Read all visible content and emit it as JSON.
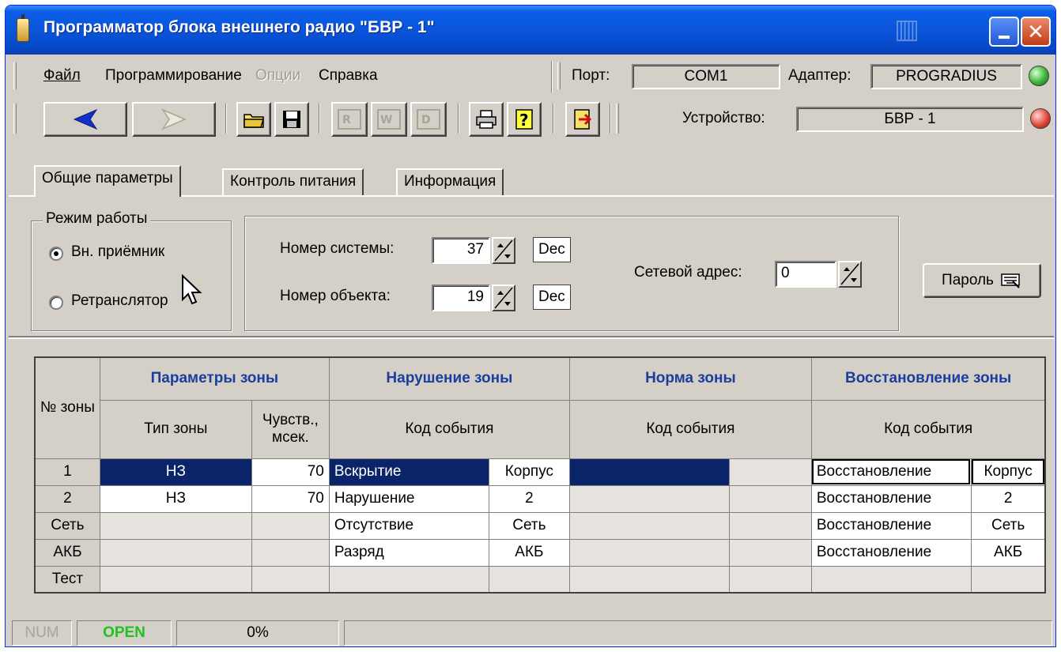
{
  "window": {
    "title": "Программатор блока внешнего радио \"БВР - 1\""
  },
  "menu": {
    "file_label": "Файл",
    "program_label": "Программирование",
    "options_label": "Опции",
    "help_label": "Справка"
  },
  "port": {
    "label": "Порт:",
    "value": "COM1"
  },
  "adapter": {
    "label": "Адаптер:",
    "value": "PROGRADIUS",
    "status_color": "#3ab33a"
  },
  "device": {
    "label": "Устройство:",
    "value": "БВР - 1",
    "status_color": "#e0483a"
  },
  "toolbar_icons": [
    "back-arrow-icon",
    "forward-arrow-icon",
    "open-folder-icon",
    "save-disk-icon",
    "read-icon",
    "write-icon",
    "verify-icon",
    "print-icon",
    "help-icon",
    "exit-icon"
  ],
  "tabs": [
    {
      "label": "Общие параметры"
    },
    {
      "label": "Контроль питания"
    },
    {
      "label": "Информация"
    }
  ],
  "mode": {
    "title": "Режим работы",
    "options": [
      {
        "label": "Вн. приёмник",
        "selected": true
      },
      {
        "label": "Ретранслятор",
        "selected": false
      }
    ]
  },
  "params": {
    "system_label": "Номер системы:",
    "system_value": "37",
    "system_base": "Dec",
    "object_label": "Номер объекта:",
    "object_value": "19",
    "object_base": "Dec",
    "net_label": "Сетевой адрес:",
    "net_value": "0",
    "password_label": "Пароль"
  },
  "grid": {
    "zone_num_header": "№ зоны",
    "group_params": "Параметры зоны",
    "group_violation": "Нарушение  зоны",
    "group_norm": "Норма зоны",
    "group_restore": "Восстановление зоны",
    "col_type": "Тип зоны",
    "col_sens": "Чувств., мсек.",
    "col_event_code": "Код события",
    "rows": [
      {
        "num": "1",
        "type": "НЗ",
        "sens": "70",
        "viol_event": "Вскрытие",
        "viol_src": "Корпус",
        "norm_event": "",
        "norm_src": "",
        "rest_event": "Восстановление",
        "rest_src": "Корпус"
      },
      {
        "num": "2",
        "type": "НЗ",
        "sens": "70",
        "viol_event": "Нарушение",
        "viol_src": "2",
        "norm_event": "",
        "norm_src": "",
        "rest_event": "Восстановление",
        "rest_src": "2"
      },
      {
        "num": "Сеть",
        "type": "",
        "sens": "",
        "viol_event": "Отсутствие",
        "viol_src": "Сеть",
        "norm_event": "",
        "norm_src": "",
        "rest_event": "Восстановление",
        "rest_src": "Сеть"
      },
      {
        "num": "АКБ",
        "type": "",
        "sens": "",
        "viol_event": "Разряд",
        "viol_src": "АКБ",
        "norm_event": "",
        "norm_src": "",
        "rest_event": "Восстановление",
        "rest_src": "АКБ"
      },
      {
        "num": "Тест",
        "type": "",
        "sens": "",
        "viol_event": "",
        "viol_src": "",
        "norm_event": "",
        "norm_src": "",
        "rest_event": "",
        "rest_src": ""
      }
    ]
  },
  "status": {
    "num": "NUM",
    "state": "OPEN",
    "state_color": "#22c022",
    "progress": "0%"
  },
  "colors": {
    "header_blue": "#1a3e9e",
    "selection": "#0a246a",
    "face": "#d4d0c8"
  }
}
